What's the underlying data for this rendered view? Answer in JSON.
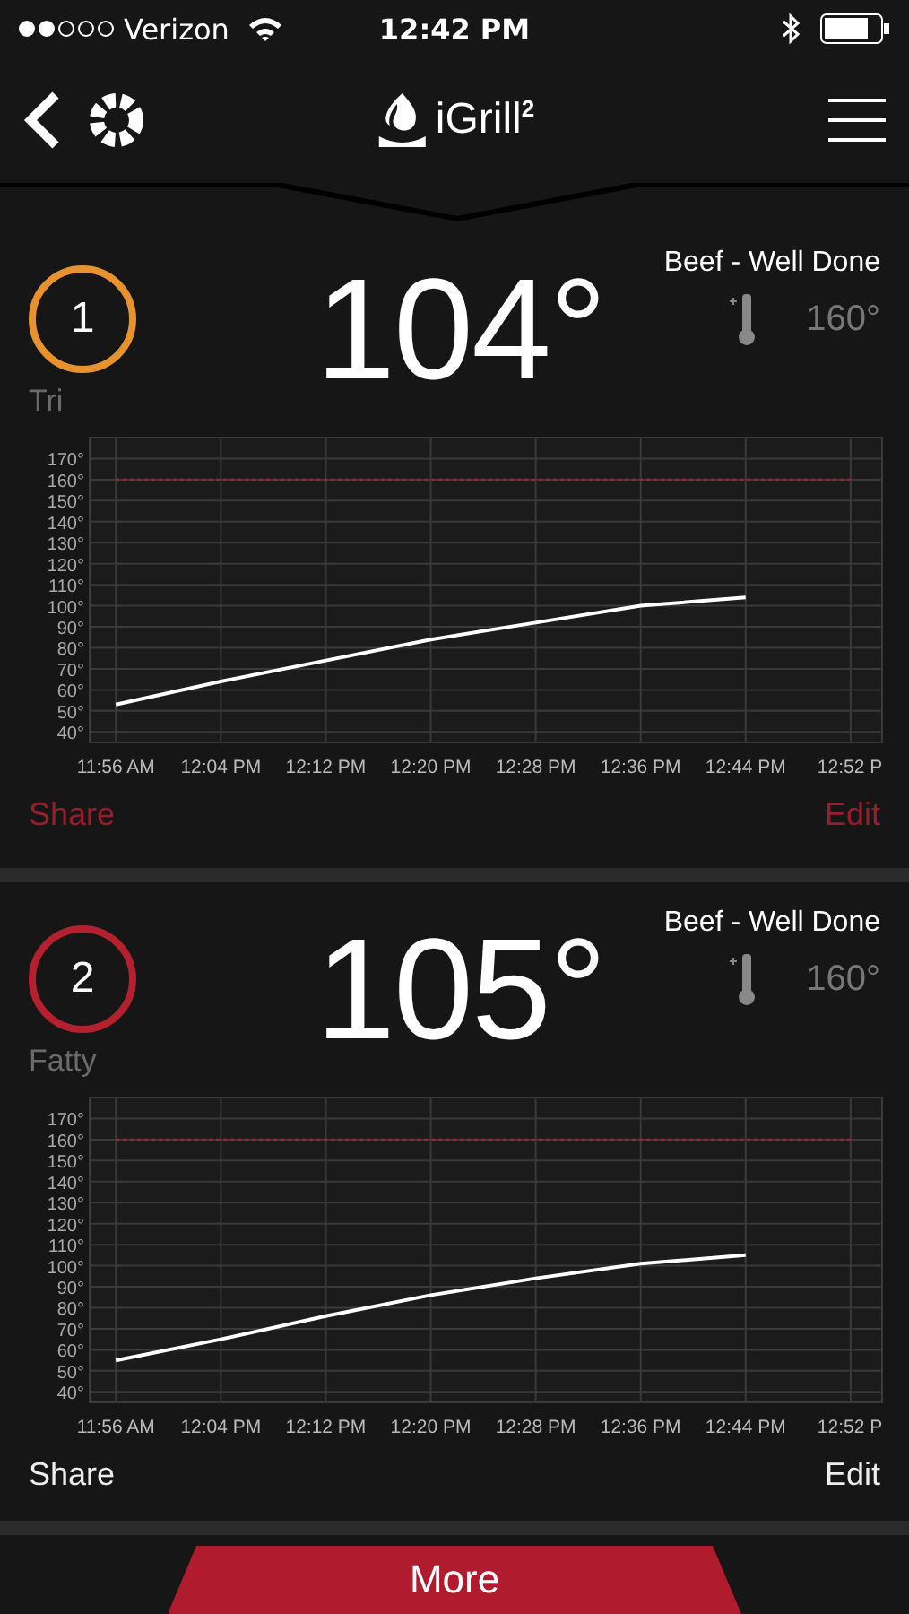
{
  "status_bar": {
    "carrier": "Verizon",
    "time": "12:42 PM"
  },
  "nav": {
    "title": "iGrill",
    "title_sup": "2"
  },
  "probes": [
    {
      "number": "1",
      "name": "Tri",
      "color": "#e8922e",
      "temperature": "104°",
      "preset": "Beef - Well Done",
      "target": "160°",
      "selected": true,
      "actions": [
        "Share",
        "Edit"
      ],
      "chart_data": {
        "type": "line",
        "categories": [
          "11:56 AM",
          "12:04 PM",
          "12:12 PM",
          "12:20 PM",
          "12:28 PM",
          "12:36 PM",
          "12:44 PM",
          "12:52 P"
        ],
        "series": [
          {
            "color": "#ffffff",
            "line_style": "solid",
            "values": [
              53,
              64,
              74,
              84,
              92,
              100,
              104,
              null
            ]
          },
          {
            "color": "#b5202e",
            "line_style": "dashed",
            "values": [
              160,
              160,
              160,
              160,
              160,
              160,
              160,
              160
            ]
          }
        ],
        "ylim": [
          35,
          180
        ],
        "yticks": [
          {
            "value": 40,
            "label": "40°"
          },
          {
            "value": 50,
            "label": "50°"
          },
          {
            "value": 60,
            "label": "60°"
          },
          {
            "value": 70,
            "label": "70°"
          },
          {
            "value": 80,
            "label": "80°"
          },
          {
            "value": 90,
            "label": "90°"
          },
          {
            "value": 100,
            "label": "100°"
          },
          {
            "value": 110,
            "label": "110°"
          },
          {
            "value": 120,
            "label": "120°"
          },
          {
            "value": 130,
            "label": "130°"
          },
          {
            "value": 140,
            "label": "140°"
          },
          {
            "value": 150,
            "label": "150°"
          },
          {
            "value": 160,
            "label": "160°"
          },
          {
            "value": 170,
            "label": "170°"
          }
        ],
        "grid": true
      }
    },
    {
      "number": "2",
      "name": "Fatty",
      "color": "#b5202e",
      "temperature": "105°",
      "preset": "Beef - Well Done",
      "target": "160°",
      "selected": false,
      "actions": [
        "Share",
        "Edit"
      ],
      "chart_data": {
        "type": "line",
        "categories": [
          "11:56 AM",
          "12:04 PM",
          "12:12 PM",
          "12:20 PM",
          "12:28 PM",
          "12:36 PM",
          "12:44 PM",
          "12:52 P"
        ],
        "series": [
          {
            "color": "#ffffff",
            "line_style": "solid",
            "values": [
              55,
              65,
              76,
              86,
              94,
              101,
              105,
              null
            ]
          },
          {
            "color": "#b5202e",
            "line_style": "dashed",
            "values": [
              160,
              160,
              160,
              160,
              160,
              160,
              160,
              160
            ]
          }
        ],
        "ylim": [
          35,
          180
        ],
        "yticks": [
          {
            "value": 40,
            "label": "40°"
          },
          {
            "value": 50,
            "label": "50°"
          },
          {
            "value": 60,
            "label": "60°"
          },
          {
            "value": 70,
            "label": "70°"
          },
          {
            "value": 80,
            "label": "80°"
          },
          {
            "value": 90,
            "label": "90°"
          },
          {
            "value": 100,
            "label": "100°"
          },
          {
            "value": 110,
            "label": "110°"
          },
          {
            "value": 120,
            "label": "120°"
          },
          {
            "value": 130,
            "label": "130°"
          },
          {
            "value": 140,
            "label": "140°"
          },
          {
            "value": 150,
            "label": "150°"
          },
          {
            "value": 160,
            "label": "160°"
          },
          {
            "value": 170,
            "label": "170°"
          }
        ],
        "grid": true
      }
    }
  ],
  "more_button": "More"
}
